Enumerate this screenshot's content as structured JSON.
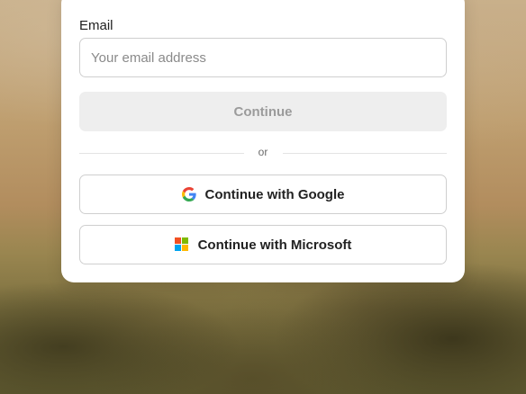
{
  "form": {
    "email_label": "Email",
    "email_placeholder": "Your email address",
    "email_value": "",
    "continue_label": "Continue",
    "divider_text": "or",
    "google_label": "Continue with Google",
    "microsoft_label": "Continue with Microsoft"
  },
  "icons": {
    "google": "google-logo-icon",
    "microsoft": "microsoft-logo-icon"
  },
  "colors": {
    "continue_disabled_bg": "#eeeeee",
    "continue_disabled_text": "#9b9b9b",
    "google_blue": "#4285F4",
    "google_red": "#EA4335",
    "google_yellow": "#FBBC05",
    "google_green": "#34A853",
    "ms_red": "#F25022",
    "ms_green": "#7FBA00",
    "ms_blue": "#00A4EF",
    "ms_yellow": "#FFB900"
  }
}
